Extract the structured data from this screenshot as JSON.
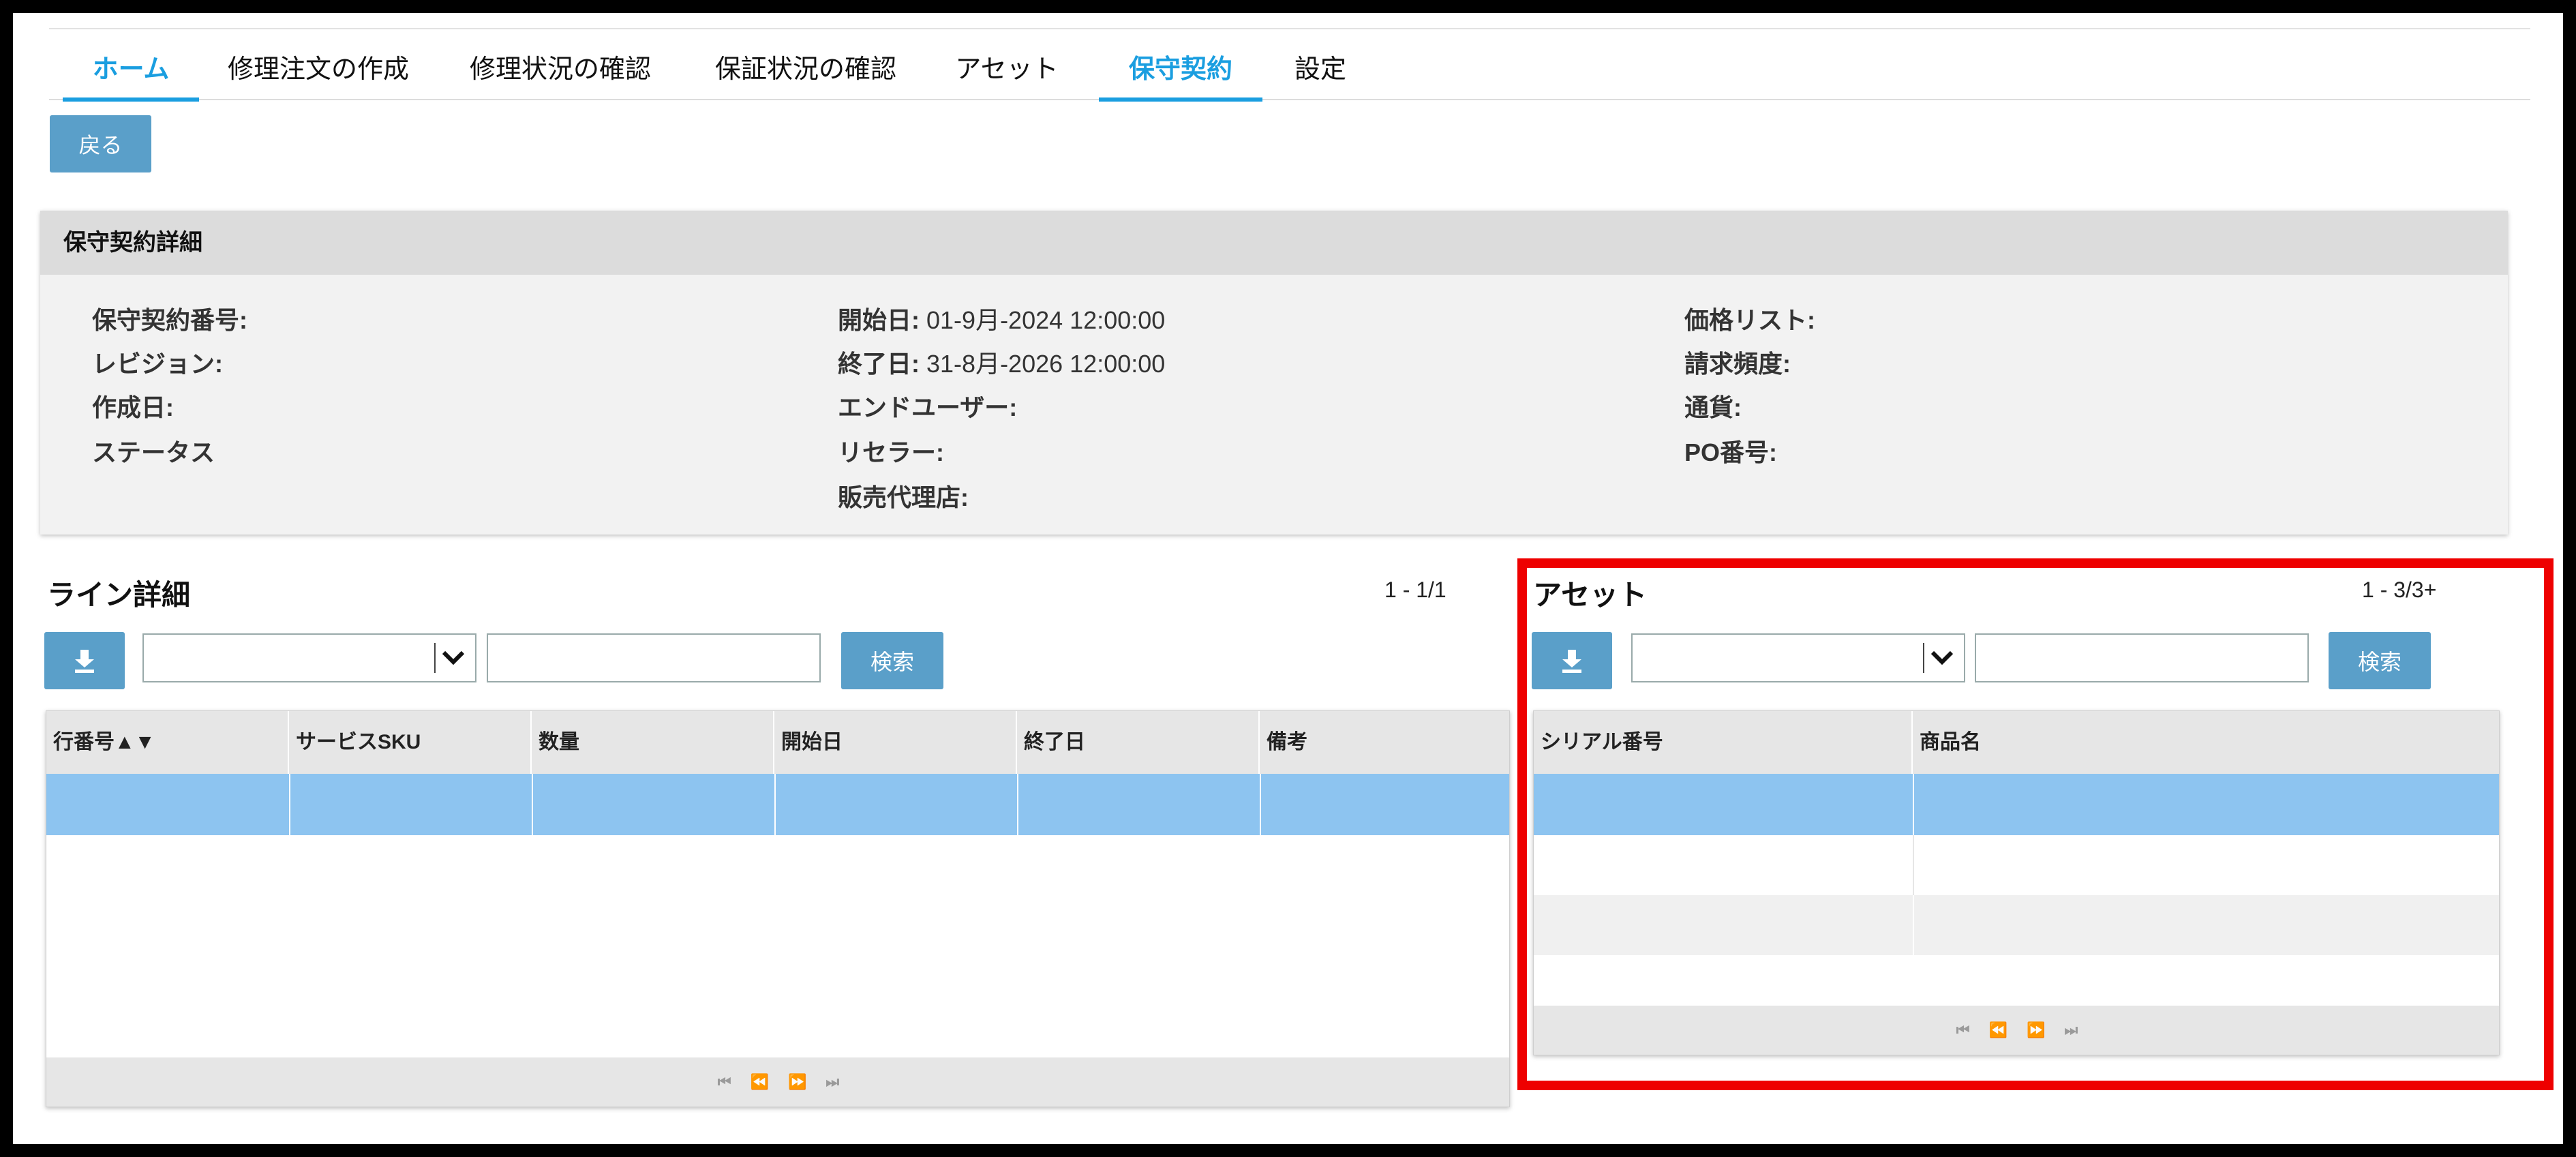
{
  "tabs": [
    {
      "label": "ホーム",
      "active": true
    },
    {
      "label": "修理注文の作成",
      "active": false
    },
    {
      "label": "修理状況の確認",
      "active": false
    },
    {
      "label": "保証状況の確認",
      "active": false
    },
    {
      "label": "アセット",
      "active": false
    },
    {
      "label": "保守契約",
      "active": true
    },
    {
      "label": "設定",
      "active": false
    }
  ],
  "back_button": "戻る",
  "details": {
    "title": "保守契約詳細",
    "col1": [
      {
        "label": "保守契約番号:",
        "value": ""
      },
      {
        "label": "レビジョン:",
        "value": ""
      },
      {
        "label": "作成日:",
        "value": ""
      },
      {
        "label": "ステータス",
        "value": ""
      }
    ],
    "col2": [
      {
        "label": "開始日:",
        "value": "01-9月-2024 12:00:00"
      },
      {
        "label": "終了日:",
        "value": "31-8月-2026 12:00:00"
      },
      {
        "label": "エンドユーザー:",
        "value": ""
      },
      {
        "label": "リセラー:",
        "value": ""
      },
      {
        "label": "販売代理店:",
        "value": ""
      }
    ],
    "col3": [
      {
        "label": "価格リスト:",
        "value": ""
      },
      {
        "label": "請求頻度:",
        "value": ""
      },
      {
        "label": "通貨:",
        "value": ""
      },
      {
        "label": "PO番号:",
        "value": ""
      }
    ]
  },
  "lines": {
    "title": "ライン詳細",
    "count": "1 - 1/1",
    "search_button": "検索",
    "columns": [
      "行番号▲▼",
      "サービスSKU",
      "数量",
      "開始日",
      "終了日",
      "備考"
    ],
    "rows": [
      [
        "",
        "",
        "",
        "",
        "",
        ""
      ]
    ]
  },
  "assets": {
    "title": "アセット",
    "count": "1 - 3/3+",
    "search_button": "検索",
    "columns": [
      "シリアル番号",
      "商品名"
    ],
    "rows": [
      [
        "",
        ""
      ],
      [
        "",
        ""
      ],
      [
        "",
        ""
      ]
    ]
  },
  "pager": [
    "⏮",
    "⏪",
    "⏩",
    "⏭"
  ],
  "colors": {
    "accent": "#1a9ee0",
    "button": "#5a9fc9",
    "selected_row": "#8dc4f0",
    "highlight": "#ee0000"
  }
}
